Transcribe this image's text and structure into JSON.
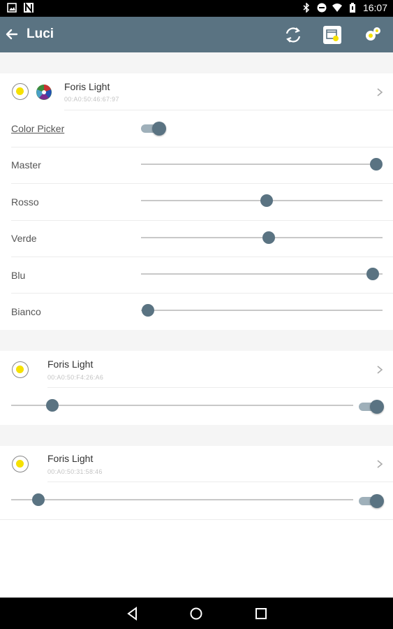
{
  "status_bar": {
    "time": "16:07",
    "icons": [
      "image-icon",
      "n-icon",
      "bluetooth-icon",
      "do-not-disturb-icon",
      "wifi-icon",
      "battery-icon"
    ]
  },
  "app_bar": {
    "title": "Luci",
    "actions": [
      "sync-icon",
      "scene-icon",
      "settings-gears-icon"
    ]
  },
  "devices": [
    {
      "name": "Foris Light",
      "address": "00:A0:50:46:67:97",
      "color_picker_label": "Color Picker",
      "color_picker_on": true,
      "channels": [
        {
          "label": "Master",
          "value": 1.0
        },
        {
          "label": "Rosso",
          "value": 0.52
        },
        {
          "label": "Verde",
          "value": 0.53
        },
        {
          "label": "Blu",
          "value": 0.96
        },
        {
          "label": "Bianco",
          "value": 0.03
        }
      ]
    },
    {
      "name": "Foris Light",
      "address": "00:A0:50:F4:26:A6",
      "level": 0.12,
      "on": true
    },
    {
      "name": "Foris Light",
      "address": "00:A0:50:31:58:46",
      "level": 0.08,
      "on": true
    }
  ],
  "colors": {
    "primary": "#5a7382",
    "bulb": "#f6e100"
  },
  "nav_bar": [
    "back-triangle-icon",
    "home-circle-icon",
    "recents-square-icon"
  ]
}
